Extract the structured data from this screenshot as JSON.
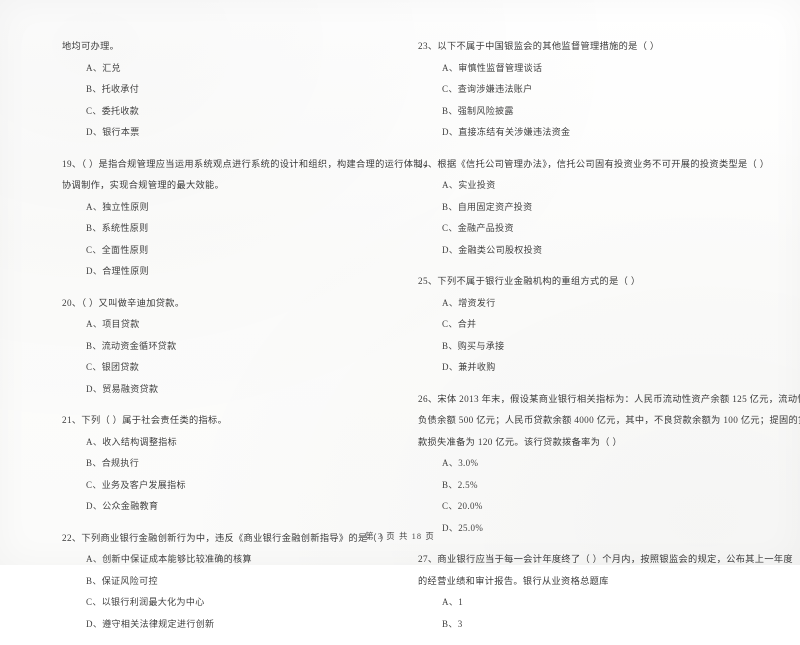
{
  "document": {
    "type": "scanned-exam-page",
    "language": "zh-CN",
    "footer": "第 3 页 共 18 页"
  },
  "left_column": {
    "lead_in": "地均可办理。",
    "lead_in_options": [
      "A、汇兑",
      "B、托收承付",
      "C、委托收款",
      "D、银行本票"
    ],
    "questions": [
      {
        "number": "19",
        "stem_line1": "19、（      ）是指合规管理应当运用系统观点进行系统的设计和组织，构建合理的运行体制，",
        "stem_line2": "协调制作，实现合规管理的最大效能。",
        "options": [
          "A、独立性原则",
          "B、系统性原则",
          "C、全面性原则",
          "D、合理性原则"
        ]
      },
      {
        "number": "20",
        "stem_line1": "20、（     ）又叫做辛迪加贷款。",
        "stem_line2": "",
        "options": [
          "A、项目贷款",
          "B、流动资金循环贷款",
          "C、银团贷款",
          "D、贸易融资贷款"
        ]
      },
      {
        "number": "21",
        "stem_line1": "21、下列（     ）属于社会责任类的指标。",
        "stem_line2": "",
        "options": [
          "A、收入结构调整指标",
          "B、合规执行",
          "C、业务及客户发展指标",
          "D、公众金融教育"
        ]
      },
      {
        "number": "22",
        "stem_line1": "22、下列商业银行金融创新行为中，违反《商业银行金融创新指导》的是（     ）",
        "stem_line2": "",
        "options": [
          "A、创新中保证成本能够比较准确的核算",
          "B、保证风险可控",
          "C、以银行利润最大化为中心",
          "D、遵守相关法律规定进行创新"
        ]
      }
    ]
  },
  "right_column": {
    "questions": [
      {
        "number": "23",
        "stem_line1": "23、以下不属于中国银监会的其他监督管理措施的是（     ）",
        "stem_line2": "",
        "options": [
          "A、审慎性监督管理谈话",
          "C、查询涉嫌违法账户",
          "B、强制风险披露",
          "D、直接冻结有关涉嫌违法资金"
        ]
      },
      {
        "number": "24",
        "stem_line1": "24、根据《信托公司管理办法》，信托公司固有投资业务不可开展的投资类型是（     ）",
        "stem_line2": "",
        "options": [
          "A、实业投资",
          "B、自用固定资产投资",
          "C、金融产品投资",
          "D、金融类公司股权投资"
        ]
      },
      {
        "number": "25",
        "stem_line1": "25、下列不属于银行业金融机构的重组方式的是（     ）",
        "stem_line2": "",
        "options": [
          "A、增资发行",
          "C、合并",
          "B、购买与承接",
          "D、兼并收购"
        ]
      },
      {
        "number": "26",
        "stem_line1": "26、宋体 2013 年末，假设某商业银行相关指标为：人民币流动性资产余额 125 亿元，流动性",
        "stem_line2": "负债余额 500 亿元；人民币贷款余额 4000 亿元，其中，不良贷款余额为 100 亿元；提固的贷",
        "stem_line3": "款损失准备为 120 亿元。该行贷款拨备率为（     ）",
        "options": [
          "A、3.0%",
          "B、2.5%",
          "C、20.0%",
          "D、25.0%"
        ]
      },
      {
        "number": "27",
        "stem_line1": "27、商业银行应当于每一会计年度终了（      ）个月内，按照银监会的规定，公布其上一年度",
        "stem_line2": "的经营业绩和审计报告。银行从业资格总题库",
        "options": [
          "A、1",
          "B、3"
        ]
      }
    ]
  }
}
